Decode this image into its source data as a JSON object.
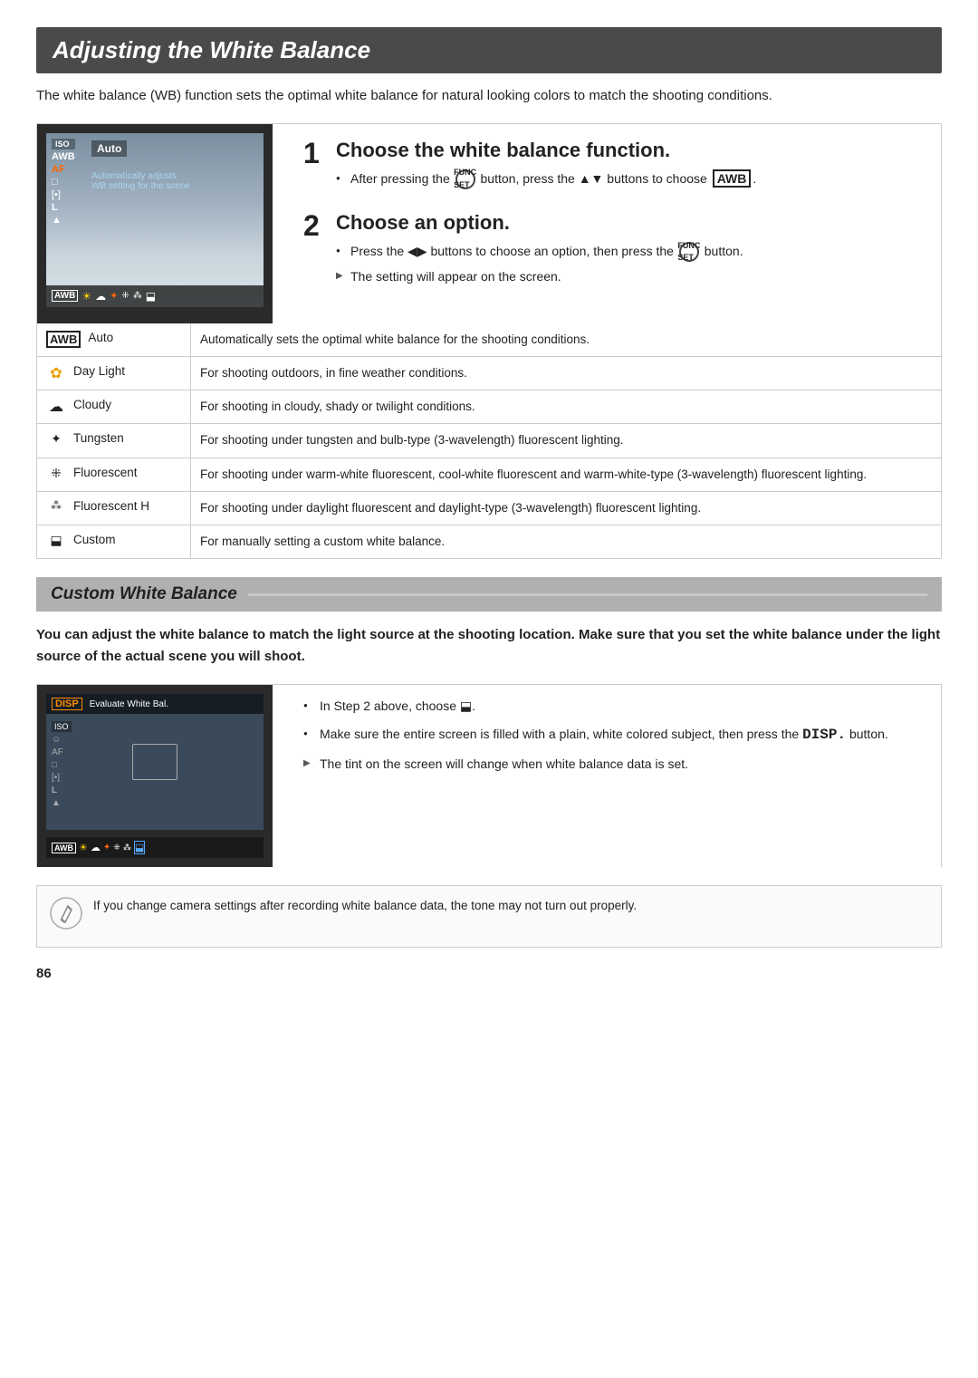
{
  "page": {
    "title": "Adjusting the White Balance",
    "intro": "The white balance (WB) function sets the optimal white balance for natural looking colors to match the shooting conditions.",
    "page_number": "86"
  },
  "step1": {
    "number": "1",
    "heading": "Choose the white balance function.",
    "bullets": [
      "After pressing the  button, press the ▲▼ buttons to choose  .",
      ""
    ],
    "bullet1": "After pressing the",
    "bullet1_mid": "button, press the ▲▼ buttons to choose",
    "bullet1_end": "."
  },
  "step2": {
    "number": "2",
    "heading": "Choose an option.",
    "bullet1": "Press the ◀▶ buttons to choose an option, then press the",
    "bullet1_end": "button.",
    "bullet2": "The setting will appear on the screen."
  },
  "wb_options": [
    {
      "icon": "AWB",
      "icon_type": "text-badge",
      "label": "Auto",
      "description": "Automatically sets the optimal white balance for the shooting conditions."
    },
    {
      "icon": "☀",
      "icon_type": "symbol",
      "label": "Day Light",
      "description": "For shooting outdoors, in fine weather conditions."
    },
    {
      "icon": "☁",
      "icon_type": "symbol",
      "label": "Cloudy",
      "description": "For shooting in cloudy, shady or twilight conditions."
    },
    {
      "icon": "💡",
      "icon_type": "symbol",
      "label": "Tungsten",
      "description": "For shooting under tungsten and bulb-type (3-wavelength) fluorescent lighting."
    },
    {
      "icon": "※",
      "icon_type": "symbol",
      "label": "Fluorescent",
      "description": "For shooting under warm-white fluorescent, cool-white fluorescent and warm-white-type (3-wavelength) fluorescent lighting."
    },
    {
      "icon": "※H",
      "icon_type": "text",
      "label": "Fluorescent H",
      "description": "For shooting under daylight fluorescent and daylight-type (3-wavelength) fluorescent lighting."
    },
    {
      "icon": "⬐",
      "icon_type": "symbol",
      "label": "Custom",
      "description": "For manually setting a custom white balance."
    }
  ],
  "custom_wb": {
    "section_title": "Custom White Balance",
    "intro": "You can adjust the white balance to match the light source at the shooting location. Make sure that you set the white balance under the light source of the actual scene you will shoot.",
    "step1": "In Step 2 above, choose",
    "step1_end": ".",
    "step2": "Make sure the entire screen is filled with a plain, white colored subject, then press the",
    "step2_disp": "DISP.",
    "step2_end": "button.",
    "step3": "The tint on the screen will change when white balance data is set."
  },
  "note": {
    "text": "If you change camera settings after recording white balance data, the tone may not turn out properly."
  },
  "camera_screen1": {
    "menu_items": [
      "AWB",
      "☀",
      "☁",
      "💡",
      "※",
      "※H",
      "⬐"
    ],
    "selected_item": "Auto",
    "sub_text": "Automatically adjusts",
    "sub_text2": "WB setting for the scene"
  },
  "camera_screen2": {
    "disp_label": "Evaluate White Bal.",
    "bottom_icons": [
      "AWB",
      "☀",
      "☁",
      "💡",
      "※",
      "※H",
      "⬐"
    ]
  }
}
